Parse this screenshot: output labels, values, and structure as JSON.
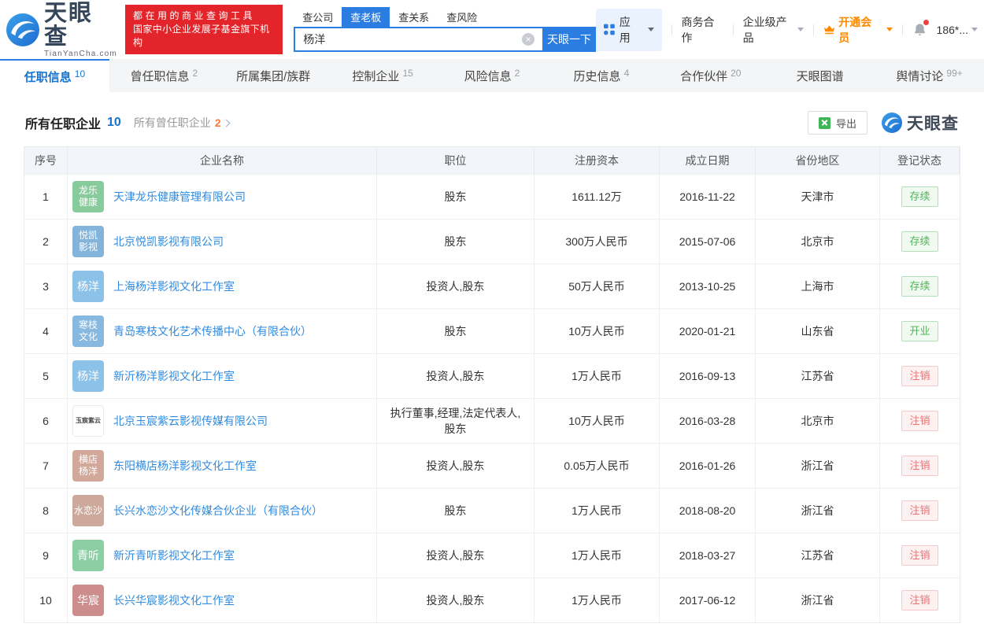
{
  "theme": {
    "primary_blue": "#2b7de1",
    "link_blue": "#2f8be0",
    "active_tab_blue": "#1673d2",
    "vip_orange": "#ff8a00",
    "banner_red": "#e3252b",
    "status_green": "#53b25b",
    "status_red": "#f26d6d"
  },
  "header": {
    "logo": {
      "title": "天眼查",
      "subtitle": "TianYanCha.com"
    },
    "banner": {
      "line1": "都在用的商业查询工具",
      "line2": "国家中小企业发展子基金旗下机构"
    },
    "search": {
      "tabs": [
        {
          "key": "search-tab-company",
          "label": "查公司",
          "active": false
        },
        {
          "key": "search-tab-boss",
          "label": "查老板",
          "active": true
        },
        {
          "key": "search-tab-relation",
          "label": "查关系",
          "active": false
        },
        {
          "key": "search-tab-risk",
          "label": "查风险",
          "active": false
        }
      ],
      "value": "杨洋",
      "button": "天眼一下"
    },
    "nav": {
      "apps": "应用",
      "business": "商务合作",
      "enterprise": "企业级产品",
      "vip": "开通会员",
      "phone": "186*..."
    }
  },
  "tabs": [
    {
      "key": "tab-positions",
      "label": "任职信息",
      "count": "10",
      "active": true
    },
    {
      "key": "tab-past-positions",
      "label": "曾任职信息",
      "count": "2",
      "active": false
    },
    {
      "key": "tab-group",
      "label": "所属集团/族群",
      "count": "",
      "active": false
    },
    {
      "key": "tab-controlled-companies",
      "label": "控制企业",
      "count": "15",
      "active": false
    },
    {
      "key": "tab-risk-info",
      "label": "风险信息",
      "count": "2",
      "active": false
    },
    {
      "key": "tab-history-info",
      "label": "历史信息",
      "count": "4",
      "active": false
    },
    {
      "key": "tab-partners",
      "label": "合作伙伴",
      "count": "20",
      "active": false
    },
    {
      "key": "tab-graph",
      "label": "天眼图谱",
      "count": "",
      "active": false
    },
    {
      "key": "tab-public-opinion",
      "label": "舆情讨论",
      "count": "99+",
      "active": false
    }
  ],
  "section": {
    "title": "所有任职企业",
    "title_count": "10",
    "sub_title": "所有曾任职企业",
    "sub_count": "2",
    "export": "导出",
    "watermark": "天眼查"
  },
  "table": {
    "columns": [
      "序号",
      "企业名称",
      "职位",
      "注册资本",
      "成立日期",
      "省份地区",
      "登记状态"
    ],
    "rows": [
      {
        "no": "1",
        "icon": {
          "lines": [
            "龙乐",
            "健康"
          ],
          "bg": "#88cb9b",
          "variant": "solid"
        },
        "name": "天津龙乐健康管理有限公司",
        "position": "股东",
        "capital": "1611.12万",
        "date": "2016-11-22",
        "region": "天津市",
        "status": "存续",
        "status_variant": "green"
      },
      {
        "no": "2",
        "icon": {
          "lines": [
            "悦凯",
            "影视"
          ],
          "bg": "#84b4da",
          "variant": "solid"
        },
        "name": "北京悦凯影视有限公司",
        "position": "股东",
        "capital": "300万人民币",
        "date": "2015-07-06",
        "region": "北京市",
        "status": "存续",
        "status_variant": "green"
      },
      {
        "no": "3",
        "icon": {
          "lines": [
            "杨洋"
          ],
          "bg": "#8cc2e8",
          "variant": "solid"
        },
        "name": "上海杨洋影视文化工作室",
        "position": "投资人,股东",
        "capital": "50万人民币",
        "date": "2013-10-25",
        "region": "上海市",
        "status": "存续",
        "status_variant": "green"
      },
      {
        "no": "4",
        "icon": {
          "lines": [
            "寒枝",
            "文化"
          ],
          "bg": "#86b8e0",
          "variant": "solid"
        },
        "name": "青岛寒枝文化艺术传播中心（有限合伙）",
        "position": "股东",
        "capital": "10万人民币",
        "date": "2020-01-21",
        "region": "山东省",
        "status": "开业",
        "status_variant": "green"
      },
      {
        "no": "5",
        "icon": {
          "lines": [
            "杨洋"
          ],
          "bg": "#8cc2e8",
          "variant": "solid"
        },
        "name": "新沂杨洋影视文化工作室",
        "position": "投资人,股东",
        "capital": "1万人民币",
        "date": "2016-09-13",
        "region": "江苏省",
        "status": "注销",
        "status_variant": "red"
      },
      {
        "no": "6",
        "icon": {
          "lines": [
            "玉宸紫云"
          ],
          "bg": "#ffffff",
          "variant": "light"
        },
        "name": "北京玉宸紫云影视传媒有限公司",
        "position": "执行董事,经理,法定代表人,股东",
        "capital": "10万人民币",
        "date": "2016-03-28",
        "region": "北京市",
        "status": "注销",
        "status_variant": "red"
      },
      {
        "no": "7",
        "icon": {
          "lines": [
            "横店",
            "杨洋"
          ],
          "bg": "#d2a89b",
          "variant": "solid"
        },
        "name": "东阳横店杨洋影视文化工作室",
        "position": "投资人,股东",
        "capital": "0.05万人民币",
        "date": "2016-01-26",
        "region": "浙江省",
        "status": "注销",
        "status_variant": "red"
      },
      {
        "no": "8",
        "icon": {
          "lines": [
            "水恋沙"
          ],
          "bg": "#cda99b",
          "variant": "solid"
        },
        "name": "长兴水恋沙文化传媒合伙企业（有限合伙）",
        "position": "股东",
        "capital": "1万人民币",
        "date": "2018-08-20",
        "region": "浙江省",
        "status": "注销",
        "status_variant": "red"
      },
      {
        "no": "9",
        "icon": {
          "lines": [
            "青听"
          ],
          "bg": "#8ccfa4",
          "variant": "solid"
        },
        "name": "新沂青听影视文化工作室",
        "position": "投资人,股东",
        "capital": "1万人民币",
        "date": "2018-03-27",
        "region": "江苏省",
        "status": "注销",
        "status_variant": "red"
      },
      {
        "no": "10",
        "icon": {
          "lines": [
            "华宸"
          ],
          "bg": "#cd8d8d",
          "variant": "solid"
        },
        "name": "长兴华宸影视文化工作室",
        "position": "投资人,股东",
        "capital": "1万人民币",
        "date": "2017-06-12",
        "region": "浙江省",
        "status": "注销",
        "status_variant": "red"
      }
    ]
  }
}
